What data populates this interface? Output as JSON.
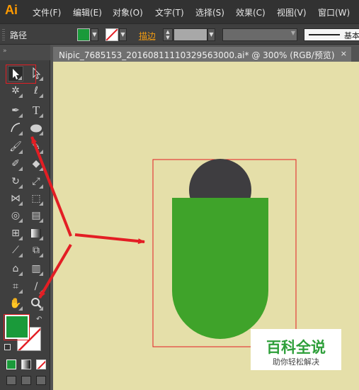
{
  "app": {
    "logo": "Ai"
  },
  "menu": [
    "文件(F)",
    "编辑(E)",
    "对象(O)",
    "文字(T)",
    "选择(S)",
    "效果(C)",
    "视图(V)",
    "窗口(W)"
  ],
  "control_bar": {
    "selection_label": "路径",
    "stroke_label": "描边",
    "stroke_profile": "基本",
    "fill_color": "#1a9a3a",
    "stroke_color": "none"
  },
  "document": {
    "tab_title": "Nipic_7685153_20160811110329563000.ai* @ 300% (RGB/预览)",
    "close_glyph": "×",
    "artboard_background": "#e5dfa9"
  },
  "artwork": {
    "circle_color": "#3e3d40",
    "body_color": "#3fa32a"
  },
  "toolbar": {
    "fill_swatch": "#1a9a3a",
    "highlight_color": "#e31e24"
  },
  "watermark": {
    "title": "百科全说",
    "subtitle": "助你轻松解决"
  }
}
